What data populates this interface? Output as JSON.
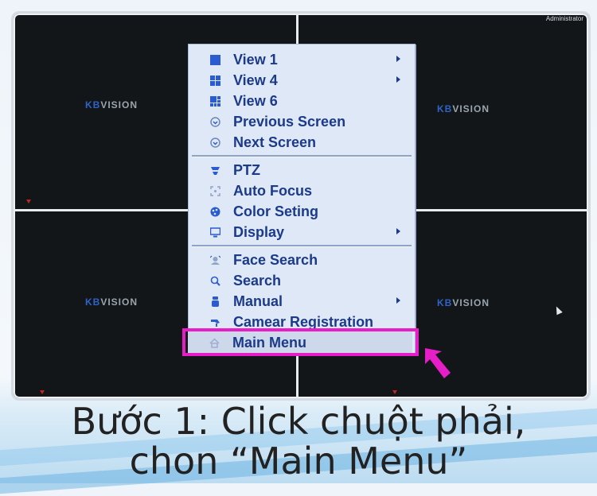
{
  "camera_view": {
    "logo_prefix": "KB",
    "logo_suffix": "VISION",
    "top_right_label": "Administrator"
  },
  "context_menu": {
    "groups": [
      [
        {
          "label": "View 1",
          "icon": "single-view-icon",
          "submenu": true
        },
        {
          "label": "View 4",
          "icon": "quad-view-icon",
          "submenu": true
        },
        {
          "label": "View 6",
          "icon": "six-view-icon",
          "submenu": false
        },
        {
          "label": "Previous Screen",
          "icon": "previous-screen-icon",
          "submenu": false
        },
        {
          "label": "Next Screen",
          "icon": "next-screen-icon",
          "submenu": false
        }
      ],
      [
        {
          "label": "PTZ",
          "icon": "ptz-icon",
          "submenu": false
        },
        {
          "label": "Auto Focus",
          "icon": "auto-focus-icon",
          "submenu": false
        },
        {
          "label": "Color Seting",
          "icon": "color-setting-icon",
          "submenu": false
        },
        {
          "label": "Display",
          "icon": "display-icon",
          "submenu": true
        }
      ],
      [
        {
          "label": "Face Search",
          "icon": "face-search-icon",
          "submenu": false
        },
        {
          "label": "Search",
          "icon": "search-icon",
          "submenu": false
        },
        {
          "label": "Manual",
          "icon": "manual-icon",
          "submenu": true
        },
        {
          "label": "Camear Registration",
          "icon": "camera-registration-icon",
          "submenu": false
        }
      ],
      [
        {
          "label": "Main Menu",
          "icon": "home-icon",
          "submenu": false
        }
      ]
    ]
  },
  "annotation": {
    "highlight_color": "#e61ec8",
    "pointer_color": "#e61ec8"
  },
  "caption": {
    "line1": "Bước 1: Click chuột phải,",
    "line2": "chon “Main Menu”"
  }
}
